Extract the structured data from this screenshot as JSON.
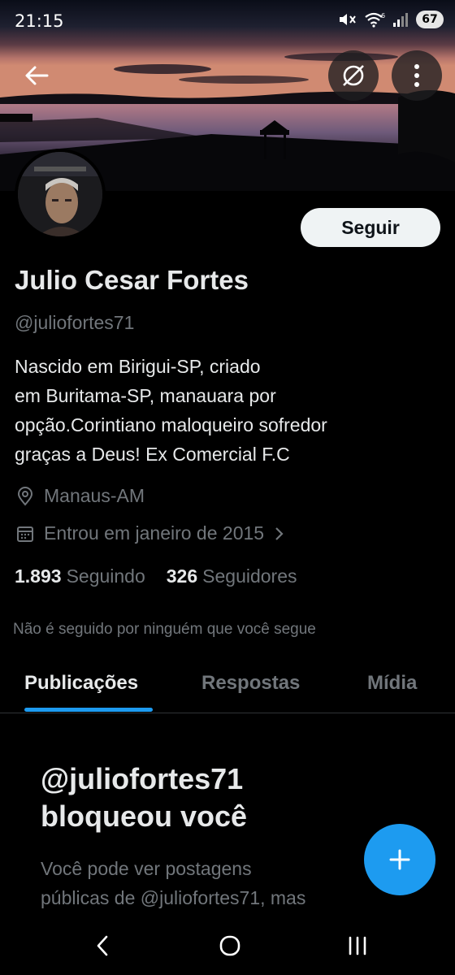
{
  "status_bar": {
    "time": "21:15",
    "battery": "67",
    "icons": [
      "mute-icon",
      "wifi-icon",
      "signal-icon",
      "battery-icon"
    ]
  },
  "header": {
    "icons": [
      "back-arrow-icon",
      "circle-slash-icon",
      "more-vertical-icon"
    ]
  },
  "profile": {
    "name": "Julio Cesar Fortes",
    "handle": "@juliofortes71",
    "follow_label": "Seguir",
    "bio_lines": [
      "Nascido em Birigui-SP, criado",
      "em Buritama-SP, manauara por",
      "opção.Corintiano maloqueiro sofredor",
      "graças a Deus! Ex Comercial F.C"
    ],
    "location": "Manaus-AM",
    "joined": "Entrou em janeiro de 2015",
    "following_count": "1.893",
    "following_label": "Seguindo",
    "followers_count": "326",
    "followers_label": "Seguidores",
    "followed_by_note": "Não é seguido por ninguém que você segue"
  },
  "tabs": [
    {
      "label": "Publicações",
      "active": true
    },
    {
      "label": "Respostas",
      "active": false
    },
    {
      "label": "Mídia",
      "active": false
    }
  ],
  "blocked": {
    "title_lines": [
      "@juliofortes71",
      "bloqueou você"
    ],
    "description_lines": [
      "Você pode ver postagens",
      "públicas de @juliofortes71, mas"
    ]
  },
  "colors": {
    "accent": "#1d9bf0",
    "background": "#000000",
    "text_primary": "#e7e9ea",
    "text_secondary": "#71767b",
    "follow_button_bg": "#eff3f4"
  },
  "navigation": {
    "icons": [
      "nav-back-icon",
      "nav-home-icon",
      "nav-recents-icon"
    ]
  }
}
